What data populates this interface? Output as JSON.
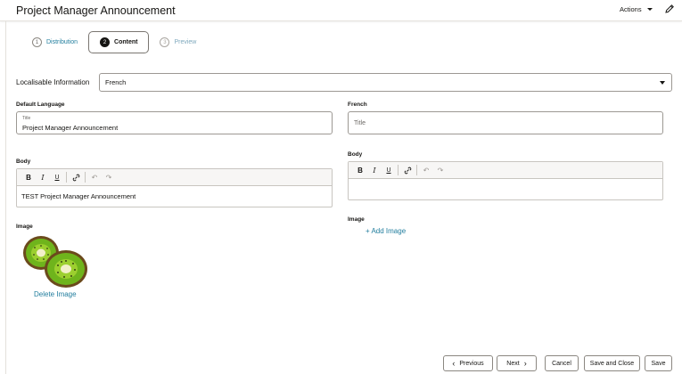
{
  "header": {
    "title": "Project Manager Announcement",
    "actions_label": "Actions"
  },
  "train": {
    "steps": [
      {
        "number": "1",
        "label": "Distribution"
      },
      {
        "number": "2",
        "label": "Content"
      },
      {
        "number": "3",
        "label": "Preview"
      }
    ],
    "active_step": 2
  },
  "localisable": {
    "label": "Localisable Information",
    "selected": "French"
  },
  "default_language": {
    "section_label": "Default Language",
    "title_label": "Title",
    "title_value": "Project Manager Announcement",
    "body_label": "Body",
    "body_value": "TEST Project Manager Announcement",
    "image_label": "Image",
    "delete_image_label": "Delete Image"
  },
  "french": {
    "section_label": "French",
    "title_placeholder": "Title",
    "body_label": "Body",
    "body_value": "",
    "image_label": "Image",
    "add_image_label": "+ Add Image"
  },
  "toolbar_icons": [
    "bold-icon",
    "italic-icon",
    "underline-icon",
    "link-icon",
    "undo-icon",
    "redo-icon"
  ],
  "footer": {
    "previous_label": "Previous",
    "next_label": "Next",
    "cancel_label": "Cancel",
    "save_close_label": "Save and Close",
    "save_label": "Save"
  },
  "colors": {
    "link": "#227e9e",
    "text": "#161513",
    "border": "#9c9893"
  }
}
